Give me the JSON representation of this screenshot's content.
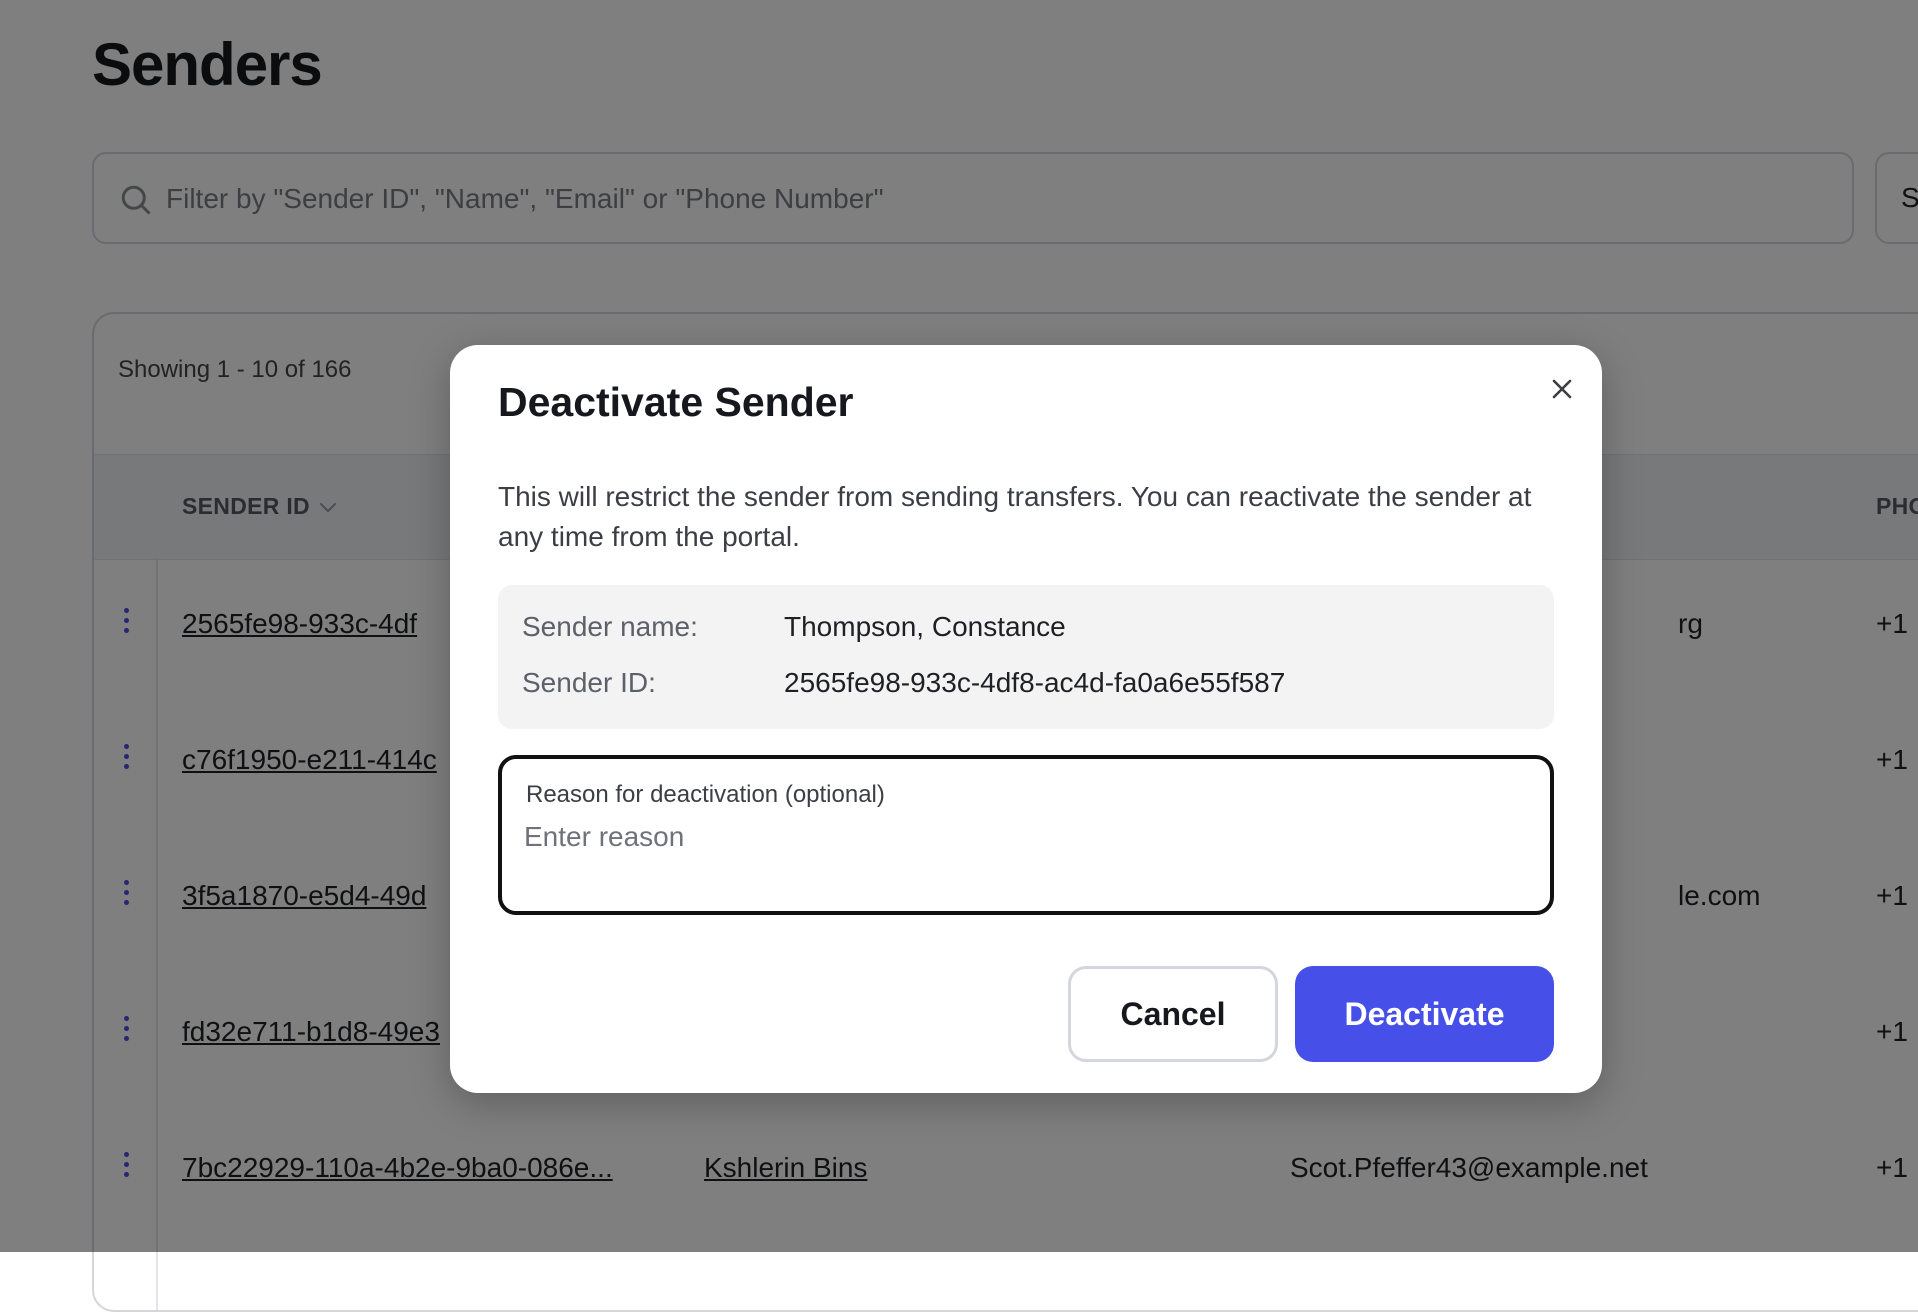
{
  "page": {
    "title": "Senders"
  },
  "search": {
    "placeholder": "Filter by \"Sender ID\", \"Name\", \"Email\" or \"Phone Number\"",
    "side_control_text": "S"
  },
  "table": {
    "showing": "Showing 1 - 10 of 166",
    "columns": {
      "sender_id": "SENDER ID",
      "phone": "PHO"
    },
    "rows": [
      {
        "sender_id": "2565fe98-933c-4df",
        "name": "",
        "email": "rg",
        "phone": "+1"
      },
      {
        "sender_id": "c76f1950-e211-414c",
        "name": "",
        "email": "",
        "phone": "+1"
      },
      {
        "sender_id": "3f5a1870-e5d4-49d",
        "name": "",
        "email": "le.com",
        "phone": "+1"
      },
      {
        "sender_id": "fd32e711-b1d8-49e3",
        "name": "",
        "email": "",
        "phone": "+1"
      },
      {
        "sender_id": "7bc22929-110a-4b2e-9ba0-086e...",
        "name": "Kshlerin Bins",
        "email": "Scot.Pfeffer43@example.net",
        "phone": "+1"
      }
    ]
  },
  "modal": {
    "title": "Deactivate Sender",
    "description": "This will restrict the sender from sending transfers. You can reactivate the sender at any time from the portal.",
    "sender_name_label": "Sender name:",
    "sender_name_value": "Thompson, Constance",
    "sender_id_label": "Sender ID:",
    "sender_id_value": "2565fe98-933c-4df8-ac4d-fa0a6e55f587",
    "reason_label": "Reason for deactivation (optional)",
    "reason_placeholder": "Enter reason",
    "cancel_label": "Cancel",
    "deactivate_label": "Deactivate"
  },
  "icons": {
    "search": "search-icon",
    "close": "close-icon",
    "row_menu": "more-vertical-icon",
    "sort": "chevron-down-icon"
  },
  "colors": {
    "accent": "#4650e8",
    "overlay": "rgba(0,0,0,0.5)"
  }
}
